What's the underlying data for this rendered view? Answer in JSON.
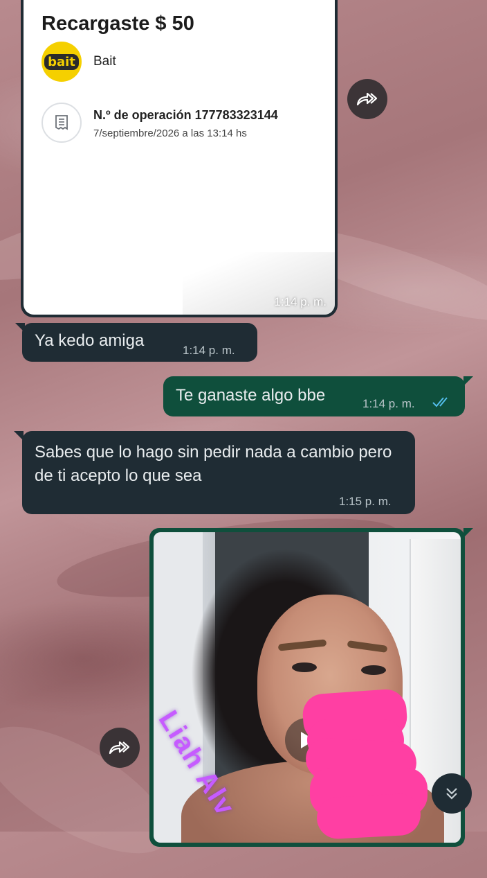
{
  "receipt": {
    "title": "Recargaste $ 50",
    "merchant_name": "Bait",
    "merchant_logo_text": "bait",
    "operation_number": "N.º de operación 177783323144",
    "operation_date": "7/septiembre/2026 a las 13:14 hs",
    "time": "1:14 p. m."
  },
  "messages": [
    {
      "direction": "incoming",
      "text": "Ya kedo amiga",
      "time": "1:14 p. m."
    },
    {
      "direction": "outgoing",
      "text": "Te ganaste algo bbe",
      "time": "1:14 p. m.",
      "status": "read"
    },
    {
      "direction": "incoming",
      "text": "Sabes que lo hago sin pedir nada a cambio pero de ti acepto lo que sea",
      "time": "1:15 p. m."
    }
  ],
  "photo_message": {
    "direction": "outgoing",
    "watermark_text": "Liah Alv",
    "redacted": true
  },
  "icons": {
    "forward": "forward-icon",
    "receipt": "receipt-icon",
    "read_receipt": "double-check-icon",
    "play": "play-icon",
    "scroll_down": "chevron-double-down-icon"
  },
  "colors": {
    "incoming_bubble": "#1f2c34",
    "outgoing_bubble": "#0f4f3c",
    "read_check": "#53bdeb",
    "redaction": "#ff3fa3"
  }
}
